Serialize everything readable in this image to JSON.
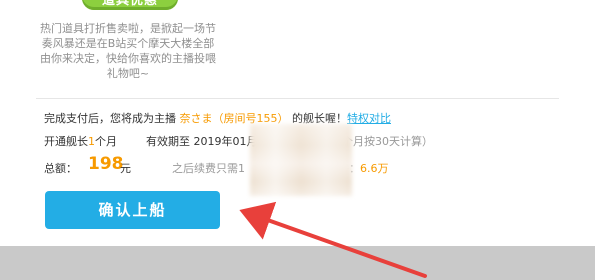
{
  "promo": {
    "badge": "道具优惠",
    "description": "热门道具打折售卖啦，是掀起一场节奏风暴还是在B站买个摩天大楼全部由你来决定，快给你喜欢的主播投喂礼物吧~"
  },
  "notice": {
    "prefix": "完成支付后，您将成为主播 ",
    "anchor_name": "奈さま（房间号155）",
    "suffix": " 的舰长喔！",
    "privilege_link": "特权对比"
  },
  "duration": {
    "prefix": "开通舰长",
    "months": "1",
    "suffix": "个月"
  },
  "validity": {
    "text": "有效期至 2019年01月17日"
  },
  "calc_note": "个月按30天计算）",
  "total": {
    "label": "总额：",
    "amount": "198",
    "unit": "元"
  },
  "renew_text": "之后续费只需1",
  "coin": {
    "prefix": "子：",
    "amount": "6.6万"
  },
  "confirm_button": "确认上船",
  "annotation": {
    "color": "#e8403b"
  }
}
